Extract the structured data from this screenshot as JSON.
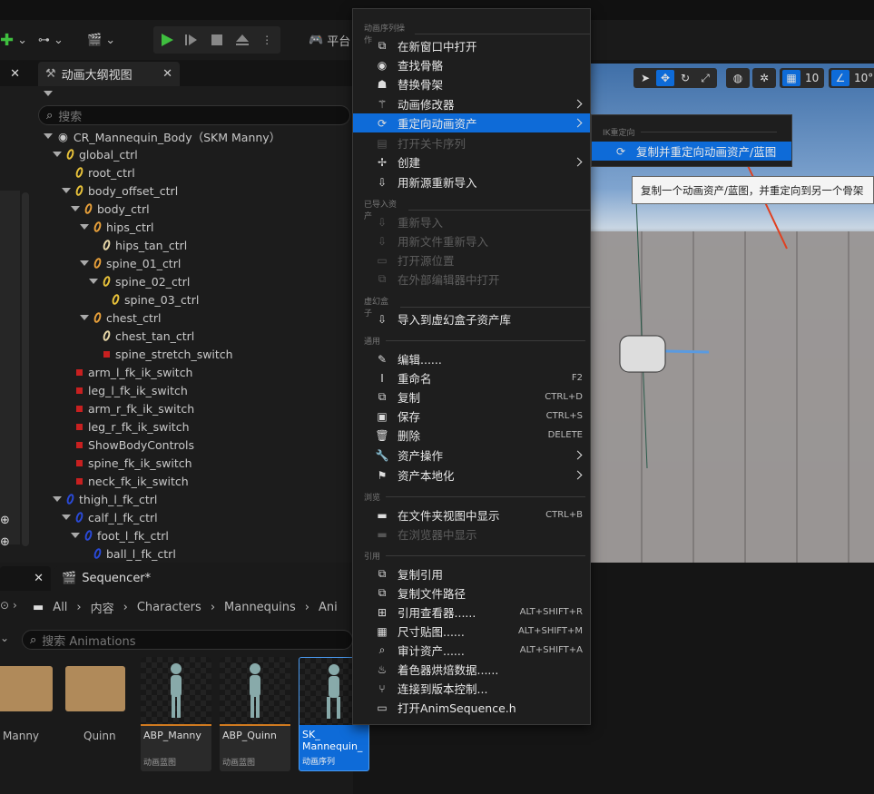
{
  "toolbar": {
    "platform_label": "平台"
  },
  "tabs": {
    "outline": "动画大纲视图",
    "sequencer": "Sequencer*"
  },
  "outline": {
    "search_placeholder": "搜索",
    "root": "CR_Mannequin_Body（SKM Manny）",
    "nodes": [
      "global_ctrl",
      "root_ctrl",
      "body_offset_ctrl",
      "body_ctrl",
      "hips_ctrl",
      "hips_tan_ctrl",
      "spine_01_ctrl",
      "spine_02_ctrl",
      "spine_03_ctrl",
      "chest_ctrl",
      "chest_tan_ctrl",
      "spine_stretch_switch",
      "arm_l_fk_ik_switch",
      "leg_l_fk_ik_switch",
      "arm_r_fk_ik_switch",
      "leg_r_fk_ik_switch",
      "ShowBodyControls",
      "spine_fk_ik_switch",
      "neck_fk_ik_switch",
      "thigh_l_fk_ctrl",
      "calf_l_fk_ctrl",
      "foot_l_fk_ctrl",
      "ball_l_fk_ctrl"
    ]
  },
  "browser": {
    "breadcrumbs": [
      "All",
      "内容",
      "Characters",
      "Mannequins",
      "Ani"
    ],
    "search_placeholder": "搜索 Animations",
    "folders": [
      "Manny",
      "Quinn"
    ],
    "assets": [
      {
        "name": "ABP_Manny",
        "type": "动画蓝图"
      },
      {
        "name": "ABP_Quinn",
        "type": "动画蓝图"
      },
      {
        "name": "SK_ Mannequin_",
        "type": "动画序列"
      }
    ]
  },
  "viewport": {
    "grid_value": "10",
    "angle_value": "10°"
  },
  "menu": {
    "sections": [
      "动画序列操作",
      "已导入资产",
      "虚幻盒子",
      "通用",
      "浏览",
      "引用"
    ],
    "items": [
      {
        "label": "在新窗口中打开",
        "shortcut": ""
      },
      {
        "label": "查找骨骼",
        "shortcut": ""
      },
      {
        "label": "替换骨架",
        "shortcut": ""
      },
      {
        "label": "动画修改器",
        "shortcut": ""
      },
      {
        "label": "重定向动画资产",
        "shortcut": ""
      },
      {
        "label": "打开关卡序列",
        "shortcut": ""
      },
      {
        "label": "创建",
        "shortcut": ""
      },
      {
        "label": "用新源重新导入",
        "shortcut": ""
      },
      {
        "label": "重新导入",
        "shortcut": ""
      },
      {
        "label": "用新文件重新导入",
        "shortcut": ""
      },
      {
        "label": "打开源位置",
        "shortcut": ""
      },
      {
        "label": "在外部编辑器中打开",
        "shortcut": ""
      },
      {
        "label": "导入到虚幻盒子资产库",
        "shortcut": ""
      },
      {
        "label": "编辑......",
        "shortcut": ""
      },
      {
        "label": "重命名",
        "shortcut": "F2"
      },
      {
        "label": "复制",
        "shortcut": "CTRL+D"
      },
      {
        "label": "保存",
        "shortcut": "CTRL+S"
      },
      {
        "label": "删除",
        "shortcut": "DELETE"
      },
      {
        "label": "资产操作",
        "shortcut": ""
      },
      {
        "label": "资产本地化",
        "shortcut": ""
      },
      {
        "label": "在文件夹视图中显示",
        "shortcut": "CTRL+B"
      },
      {
        "label": "在浏览器中显示",
        "shortcut": ""
      },
      {
        "label": "复制引用",
        "shortcut": ""
      },
      {
        "label": "复制文件路径",
        "shortcut": ""
      },
      {
        "label": "引用查看器......",
        "shortcut": "ALT+SHIFT+R"
      },
      {
        "label": "尺寸贴图......",
        "shortcut": "ALT+SHIFT+M"
      },
      {
        "label": "审计资产......",
        "shortcut": "ALT+SHIFT+A"
      },
      {
        "label": "着色器烘焙数据......",
        "shortcut": ""
      },
      {
        "label": "连接到版本控制...",
        "shortcut": ""
      },
      {
        "label": "打开AnimSequence.h",
        "shortcut": ""
      }
    ]
  },
  "submenu": {
    "section": "IK重定向",
    "item": "复制并重定向动画资产/蓝图"
  },
  "tooltip": "复制一个动画资产/蓝图，并重定向到另一个骨架",
  "colors": {
    "highlight": "#0e6bd8",
    "play": "#3fbf3f",
    "accent_red": "#e04020"
  }
}
